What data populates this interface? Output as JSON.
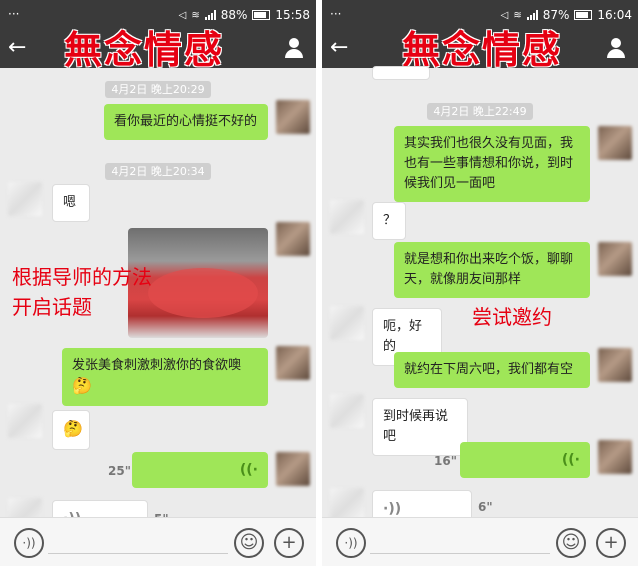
{
  "watermark": "無念情感",
  "phones": [
    {
      "status": {
        "battery": "88%",
        "time": "15:58",
        "battery_level": 0.88
      },
      "timestamps": [
        "4月2日 晚上20:29",
        "4月2日 晚上20:34"
      ],
      "messages": {
        "m1": "看你最近的心情挺不好的",
        "m2": "嗯",
        "m3": "发张美食刺激刺激你的食欲噢",
        "m3_emoji": "🤔",
        "m4_emoji": "🤔"
      },
      "voice": [
        {
          "duration": "25\""
        },
        {
          "duration": "5\""
        }
      ],
      "annotation": "根据导师的方法开启话题"
    },
    {
      "status": {
        "battery": "87%",
        "time": "16:04",
        "battery_level": 0.87
      },
      "timestamps": [
        "4月2日 晚上22:49"
      ],
      "messages": {
        "m1": "其实我们也很久没有见面，我也有一些事情想和你说，到时候我们见一面吧",
        "m2": "？",
        "m3": "就是想和你出来吃个饭，聊聊天，就像朋友间那样",
        "m4": "呃，好的",
        "m5": "就约在下周六吧，我们都有空",
        "m6": "到时候再说吧"
      },
      "voice": [
        {
          "duration": "16\""
        },
        {
          "duration": "6\""
        }
      ],
      "annotation": "尝试邀约"
    }
  ],
  "icons": {
    "back": "arrow-left-icon",
    "profile": "person-icon",
    "voice_toggle": "voice-icon",
    "emoji": "smiley-icon",
    "plus": "plus-icon"
  },
  "colors": {
    "outgoing_bubble": "#9fe658",
    "incoming_bubble": "#ffffff",
    "header": "#3a3a3a",
    "watermark": "#e60012",
    "chat_background": "#ebebeb"
  }
}
